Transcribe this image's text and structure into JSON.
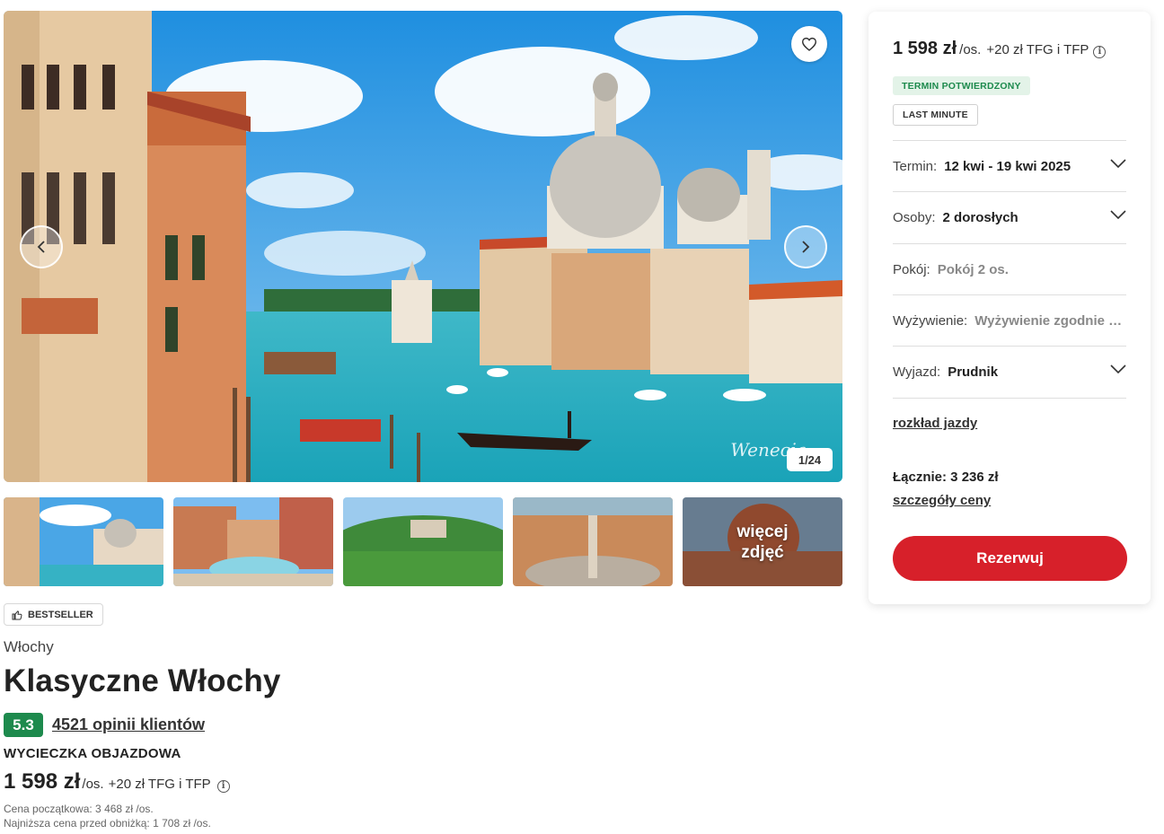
{
  "gallery": {
    "watermark": "Wenecja",
    "counter": "1/24",
    "more_photos_line1": "więcej",
    "more_photos_line2": "zdjęć"
  },
  "offer": {
    "badge": "BESTSELLER",
    "country": "Włochy",
    "title": "Klasyczne Włochy",
    "rating": "5.3",
    "reviews": "4521 opinii klientów",
    "tour_type": "WYCIECZKA OBJAZDOWA",
    "price": "1 598 zł",
    "price_unit": "/os.",
    "price_extra": "+20 zł TFG i TFP",
    "initial_price": "Cena początkowa: 3 468 zł /os.",
    "lowest_price": "Najniższa cena przed obniżką: 1 708 zł /os."
  },
  "booking": {
    "price": "1 598 zł",
    "price_unit": "/os.",
    "price_extra": "+20 zł TFG i TFP",
    "tag_confirmed": "TERMIN POTWIERDZONY",
    "tag_last_minute": "LAST MINUTE",
    "options": [
      {
        "label": "Termin:",
        "value": "12 kwi - 19 kwi 2025"
      },
      {
        "label": "Osoby:",
        "value": "2 dorosłych"
      },
      {
        "label": "Pokój:",
        "value": "Pokój 2 os."
      },
      {
        "label": "Wyżywienie:",
        "value": "Wyżywienie zgodnie z programem"
      },
      {
        "label": "Wyjazd:",
        "value": "Prudnik"
      }
    ],
    "schedule_link": "rozkład jazdy",
    "total": "Łącznie: 3 236 zł",
    "price_details_link": "szczegóły ceny",
    "book_button": "Rezerwuj"
  },
  "colors": {
    "accent_red": "#d7202a",
    "rating_green": "#1d8a4d",
    "confirmed_bg": "#e3f3e8"
  },
  "icons": [
    "heart-icon",
    "chevron-left-icon",
    "chevron-right-icon",
    "thumbs-up-icon",
    "info-icon",
    "chevron-down-icon"
  ]
}
